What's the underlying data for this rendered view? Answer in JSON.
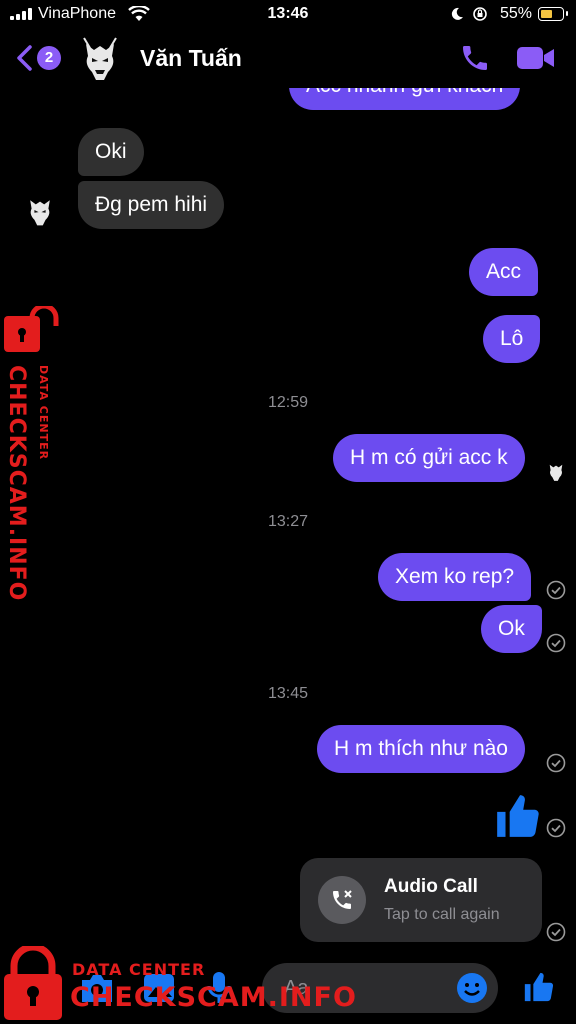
{
  "status_bar": {
    "carrier": "VinaPhone",
    "time": "13:46",
    "battery": "55%"
  },
  "header": {
    "back_count": "2",
    "contact_name": "Văn Tuấn"
  },
  "messages": {
    "top_partial": "Acc nhanh gửi khách",
    "in_1": "Oki",
    "in_2": "Đg pem hihi",
    "out_1": "Acc",
    "out_2": "Lô",
    "ts_1": "12:59",
    "out_3": "H m có gửi acc k",
    "ts_2": "13:27",
    "out_4": "Xem ko rep?",
    "out_5": "Ok",
    "ts_3": "13:45",
    "out_6": "H m thích như nào"
  },
  "call_card": {
    "title": "Audio Call",
    "subtitle": "Tap to call again"
  },
  "composer": {
    "placeholder": "Aa"
  },
  "watermark": {
    "brand": "CHECKSCAM.INFO",
    "tag": "DATA CENTER"
  },
  "colors": {
    "accent": "#8b5cf6",
    "outgoing_bubble": "#6c4cf0",
    "incoming_bubble": "#303030",
    "thumb": "#1877f2",
    "watermark": "#e31d1d"
  }
}
